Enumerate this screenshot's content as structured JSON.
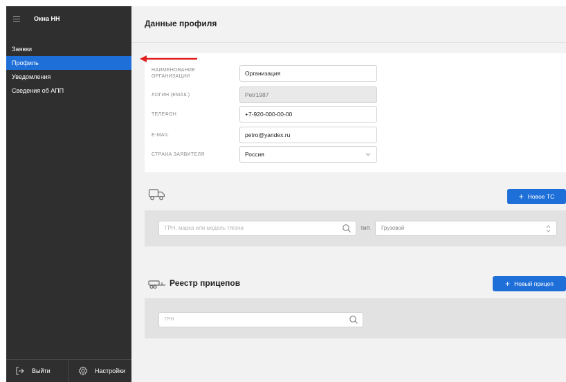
{
  "app": {
    "title": "Окна НН"
  },
  "sidebar": {
    "items": [
      {
        "label": "Заявки",
        "active": false
      },
      {
        "label": "Профиль",
        "active": true
      },
      {
        "label": "Уведомления",
        "active": false
      },
      {
        "label": "Сведения об АПП",
        "active": false
      }
    ],
    "footer": {
      "logout_label": "Выйти",
      "settings_label": "Настройки"
    }
  },
  "page": {
    "title": "Данные профиля"
  },
  "profile": {
    "org_label": "НАИМЕНОВАНИЕ ОРГАНИЗАЦИИ",
    "org_value": "Организация",
    "login_label": "ЛОГИН (EMAIL)",
    "login_value": "Petr1987",
    "phone_label": "ТЕЛЕФОН",
    "phone_value": "+7-920-000-00-00",
    "email_label": "E-MAIL",
    "email_value": "petro@yandex.ru",
    "country_label": "СТРАНА ЗАЯВИТЕЛЯ",
    "country_value": "Россия"
  },
  "vehicles": {
    "new_button": "Новое ТС",
    "search_placeholder": "ГРН, марка или модель тягача",
    "type_label": "тип",
    "type_value": "Грузовой"
  },
  "trailers": {
    "title": "Реестр прицепов",
    "new_button": "Новый прицеп",
    "search_placeholder": "ГРН"
  },
  "colors": {
    "accent": "#1f6fd8",
    "sidebar_bg": "#2f2f2f",
    "annotation_arrow": "#e02020"
  }
}
